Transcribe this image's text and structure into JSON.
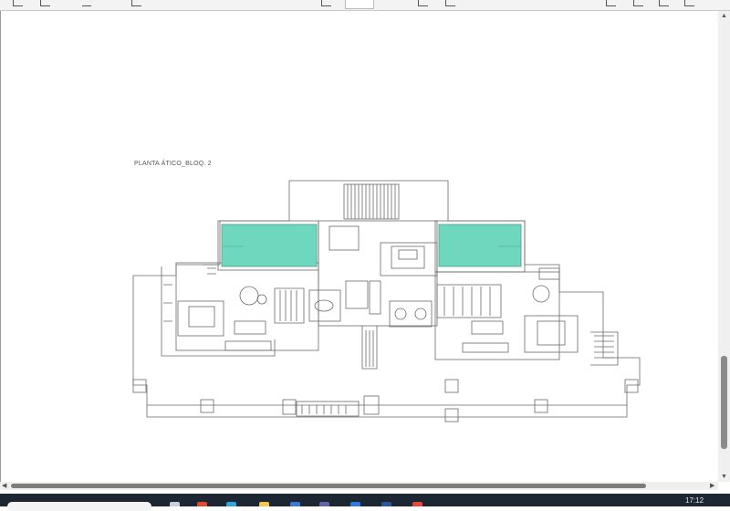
{
  "drawing": {
    "title": "PLANTA ÁTICO_BLOQ. 2",
    "pool_color": "#6fd7bd"
  },
  "taskbar": {
    "clock": "17:12"
  }
}
